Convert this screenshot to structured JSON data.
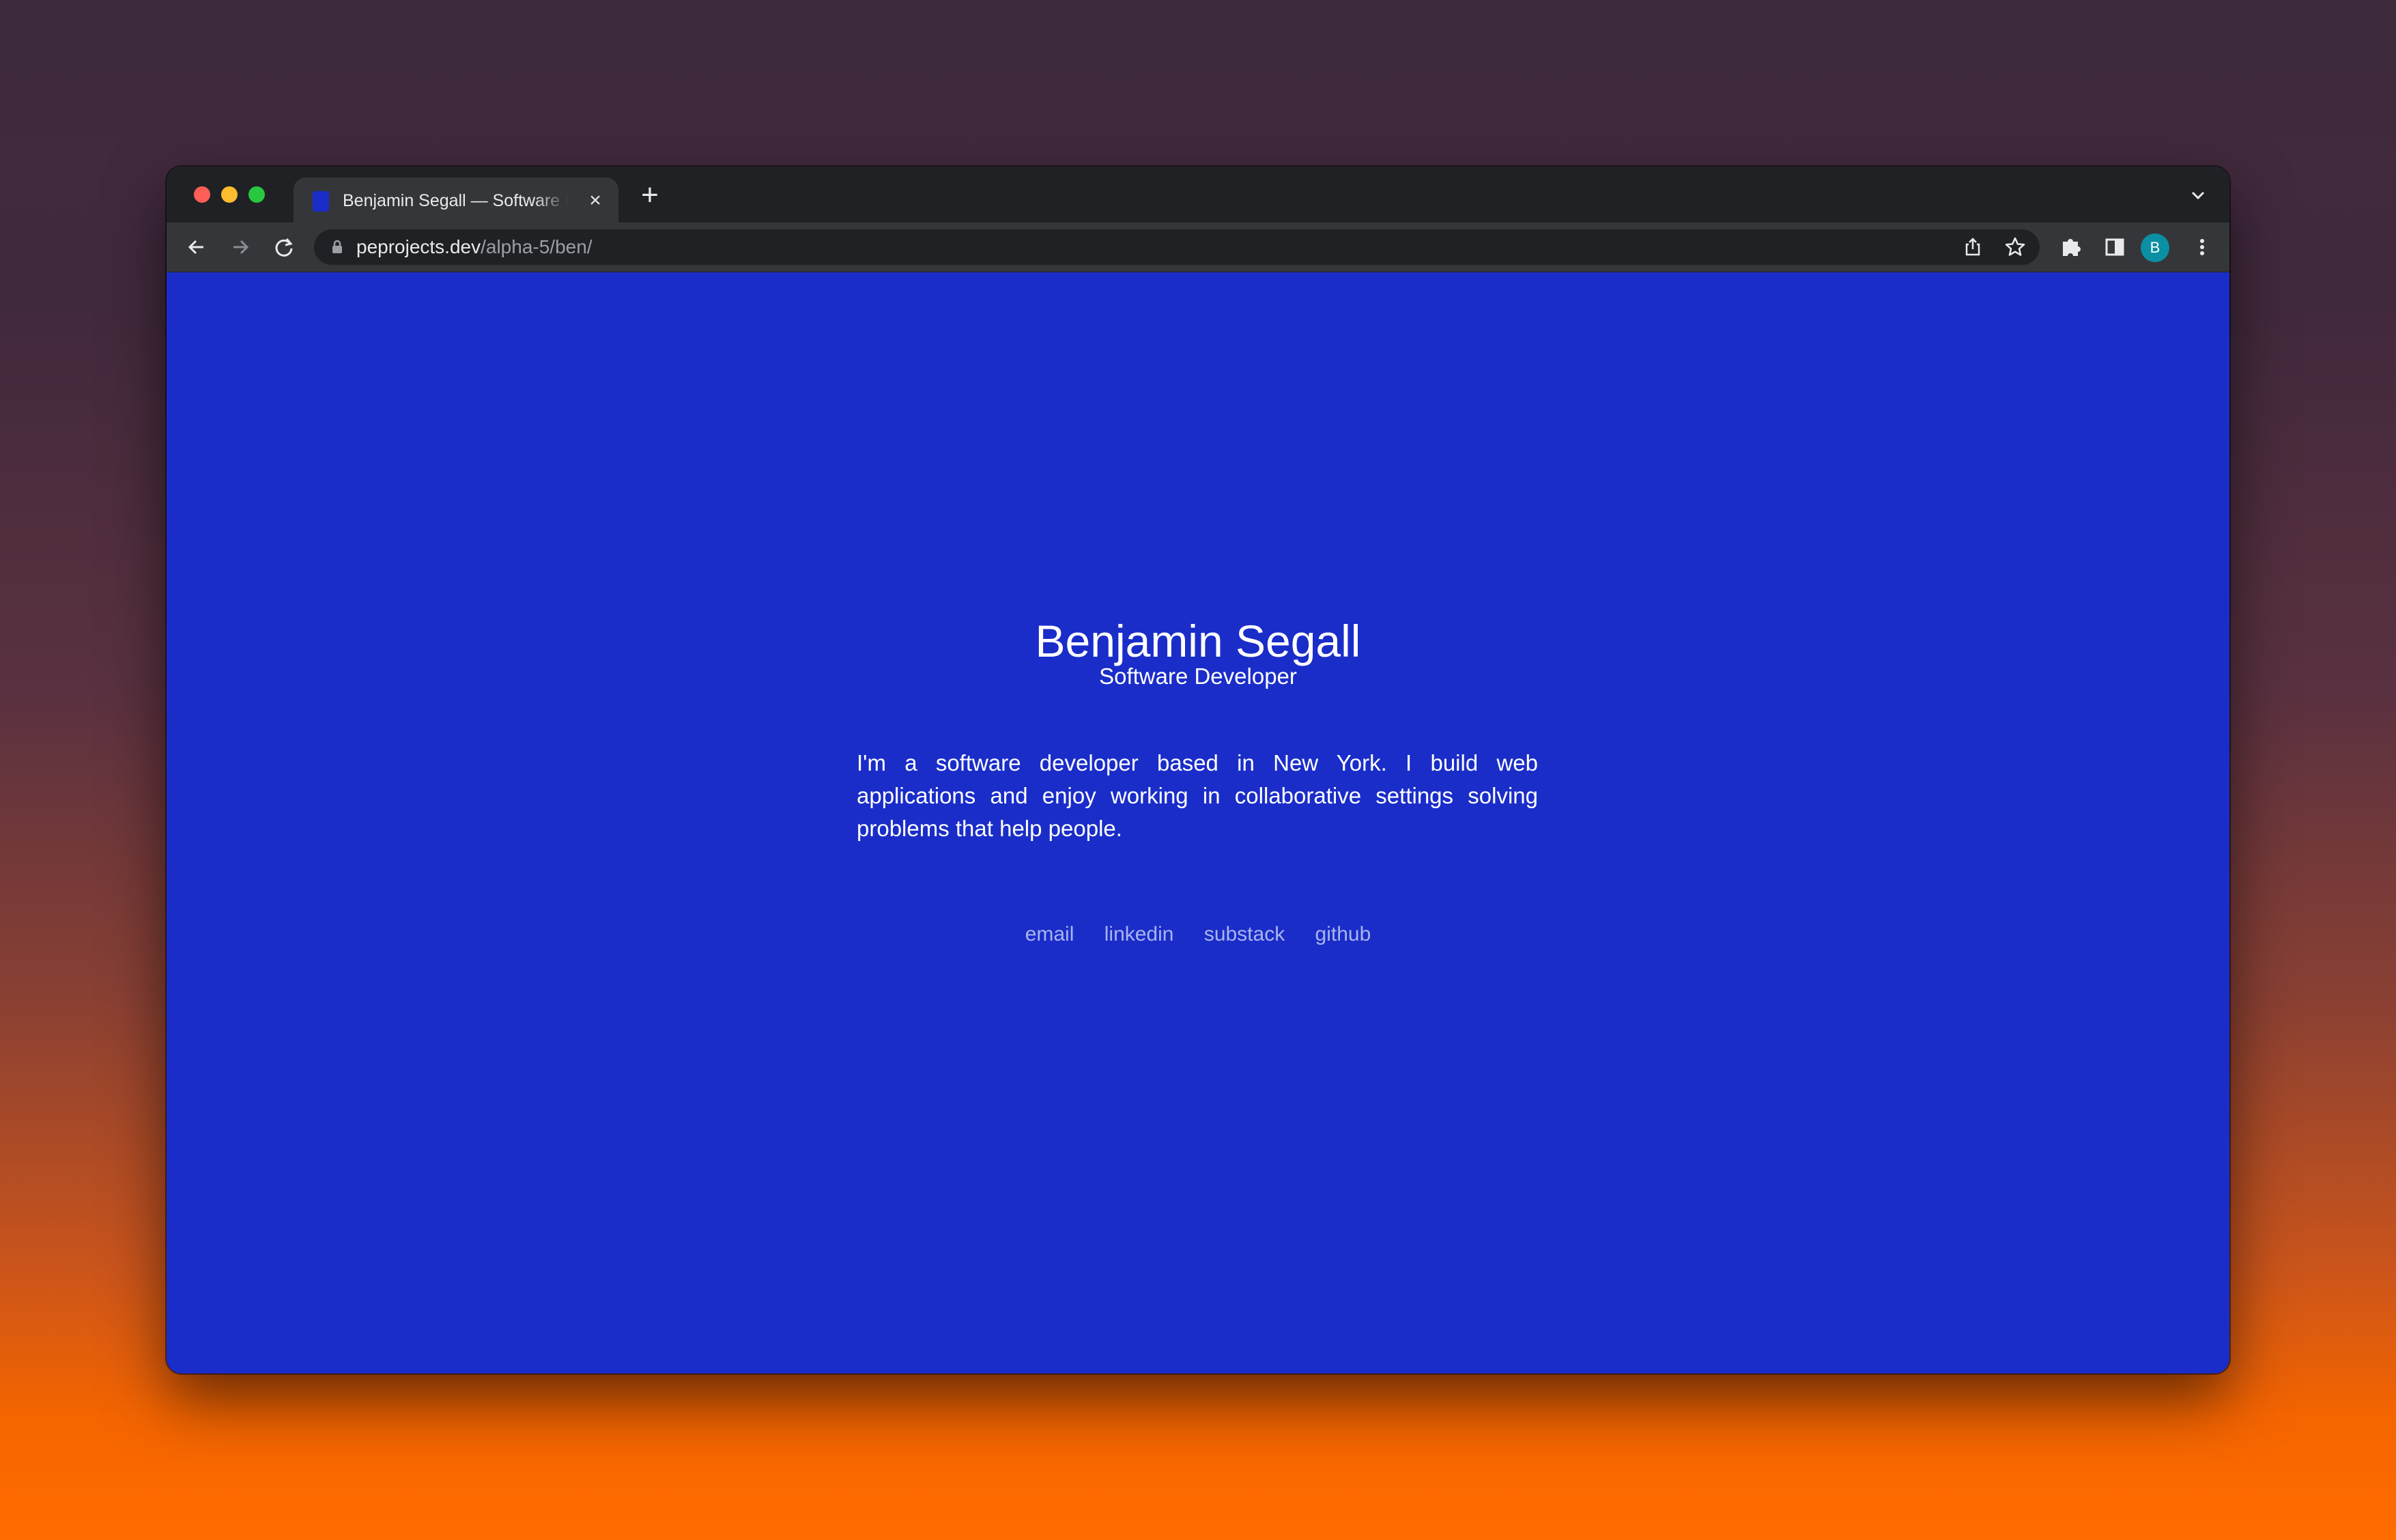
{
  "browser": {
    "tab": {
      "title": "Benjamin Segall — Software Developer",
      "close_icon": "close-icon",
      "favicon": "person-favicon-icon"
    },
    "new_tab_icon": "plus-icon",
    "tab_search_icon": "chevron-down-icon",
    "toolbar": {
      "back_icon": "arrow-left-icon",
      "forward_icon": "arrow-right-icon",
      "reload_icon": "reload-icon",
      "lock_icon": "lock-icon",
      "url_host": "peprojects.dev",
      "url_path": "/alpha-5/ben/",
      "share_icon": "share-icon",
      "bookmark_icon": "star-icon",
      "extensions_icon": "puzzle-icon",
      "side_panel_icon": "side-panel-icon",
      "profile_initial": "B",
      "menu_icon": "kebab-menu-icon"
    }
  },
  "page": {
    "background_color": "#1a2dc9",
    "name": "Benjamin Segall",
    "role": "Software Developer",
    "bio": "I'm a software developer based in New York. I build web applications and enjoy working in collaborative settings solving problems that help people.",
    "links": [
      {
        "label": "email"
      },
      {
        "label": "linkedin"
      },
      {
        "label": "substack"
      },
      {
        "label": "github"
      }
    ]
  }
}
